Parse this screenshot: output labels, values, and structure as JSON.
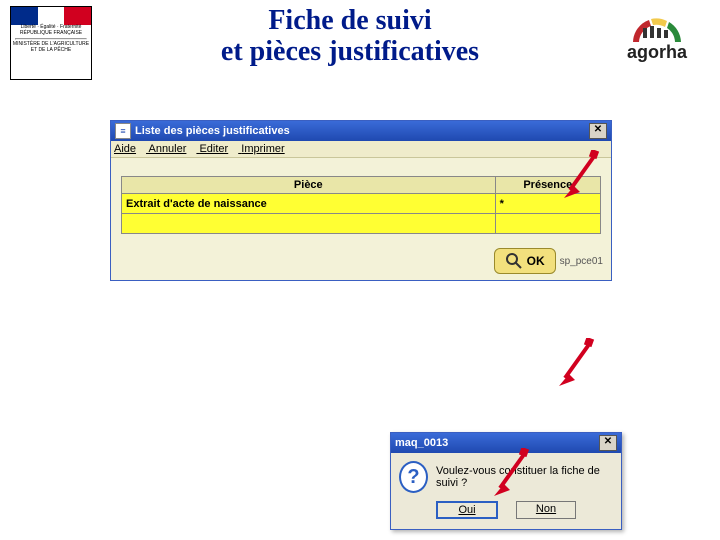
{
  "header": {
    "title_line1": "Fiche de suivi",
    "title_line2": "et pièces justificatives",
    "min_text1": "Liberté · Égalité · Fraternité",
    "min_text2": "RÉPUBLIQUE FRANÇAISE",
    "min_text3": "MINISTÈRE DE L'AGRICULTURE ET DE LA PÊCHE",
    "agorha": "agorha"
  },
  "win": {
    "title": "Liste des pièces justificatives",
    "menu": {
      "aide": "Aide",
      "annuler": "Annuler",
      "editer": "Editer",
      "imprimer": "Imprimer"
    },
    "col_piece": "Pièce",
    "col_presence": "Présence",
    "rows": [
      {
        "piece": "Extrait d'acte de naissance",
        "presence": "*"
      }
    ],
    "ok": "OK",
    "ok_name": "sp_pce01"
  },
  "dialog": {
    "title": "maq_0013",
    "message": "Voulez-vous constituer la fiche de suivi ?",
    "yes": "Oui",
    "no": "Non"
  }
}
